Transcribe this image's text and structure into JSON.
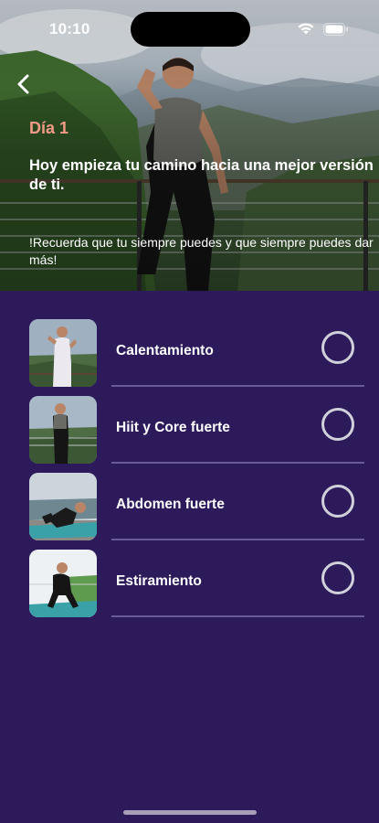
{
  "status_bar": {
    "time": "10:10",
    "icons": [
      "wifi-icon",
      "battery-icon"
    ]
  },
  "header": {
    "back_icon": "chevron-left-icon",
    "day": "Día 1",
    "headline": "Hoy empieza tu camino hacia una mejor versión de ti.",
    "reminder": "!Recuerda que tu siempre puedes y que siempre puedes dar más!"
  },
  "workouts": [
    {
      "title": "Calentamiento",
      "completed": false
    },
    {
      "title": "Hiit y Core fuerte",
      "completed": false
    },
    {
      "title": "Abdomen fuerte",
      "completed": false
    },
    {
      "title": "Estiramiento",
      "completed": false
    }
  ],
  "colors": {
    "background": "#2c1a5b",
    "day_label": "#f29a88",
    "divider": "#6a5a99",
    "circle": "#cfd0da"
  }
}
